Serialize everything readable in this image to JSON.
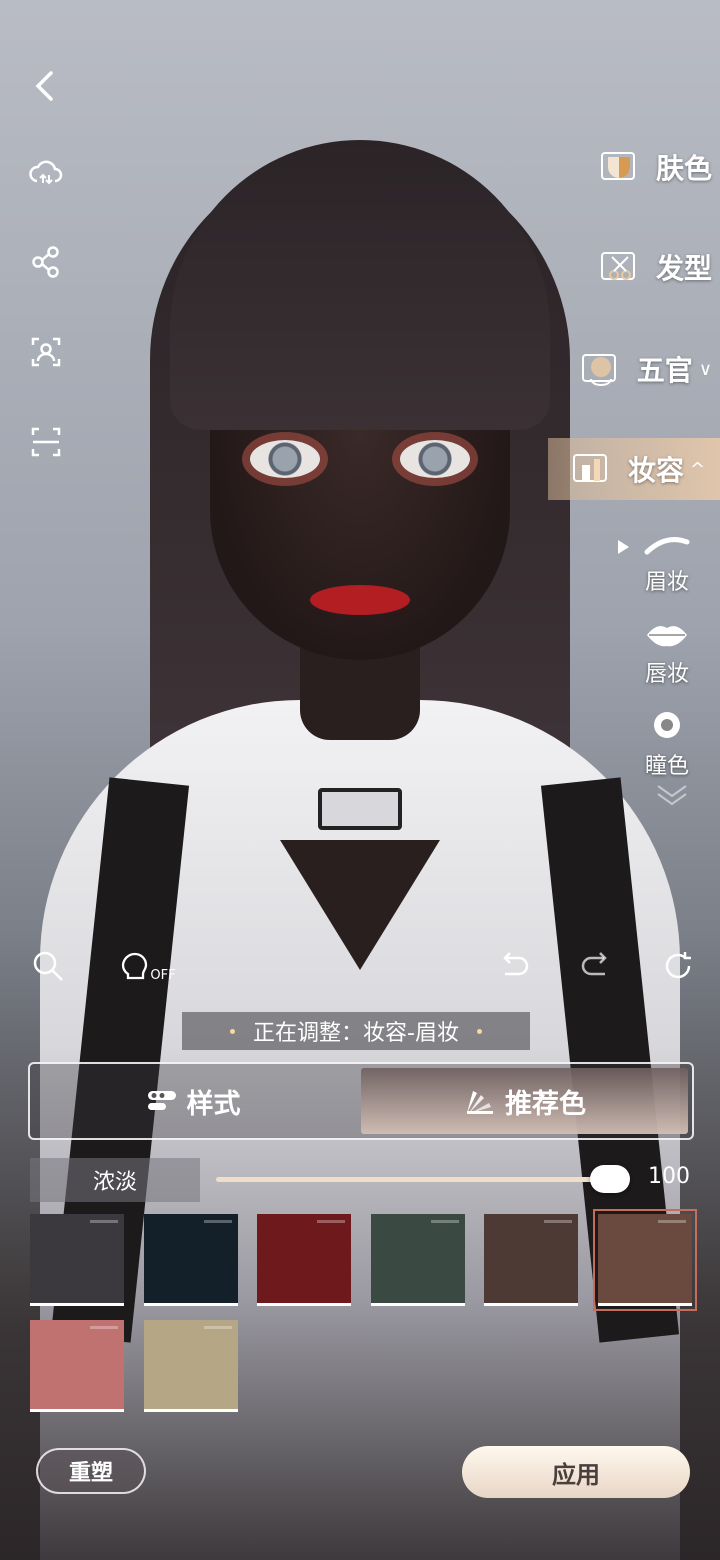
{
  "right_menu": {
    "items": [
      {
        "label": "肤色"
      },
      {
        "label": "发型"
      },
      {
        "label": "五官",
        "chevron": "∨"
      },
      {
        "label": "妆容",
        "chevron": "^"
      }
    ],
    "sub_items": [
      {
        "label": "眉妆",
        "icon": "eyebrow-icon"
      },
      {
        "label": "唇妆",
        "icon": "lips-icon"
      },
      {
        "label": "瞳色",
        "icon": "eye-color-icon"
      }
    ]
  },
  "tools": {
    "face_toggle": "OFF"
  },
  "status": {
    "text": "正在调整：妆容-眉妆"
  },
  "tabs": [
    {
      "label": "样式"
    },
    {
      "label": "推荐色"
    }
  ],
  "intensity": {
    "label": "浓淡",
    "value": "100",
    "level": 1.0
  },
  "swatches": [
    {
      "color": "#3b393e"
    },
    {
      "color": "#13202a"
    },
    {
      "color": "#6e1a1c"
    },
    {
      "color": "#3a4a43"
    },
    {
      "color": "#4e3a35"
    },
    {
      "color": "#6a4a3e",
      "selected": true
    },
    {
      "color": "#c07270"
    },
    {
      "color": "#b5a785"
    }
  ],
  "actions": {
    "reset": "重塑",
    "apply": "应用"
  }
}
